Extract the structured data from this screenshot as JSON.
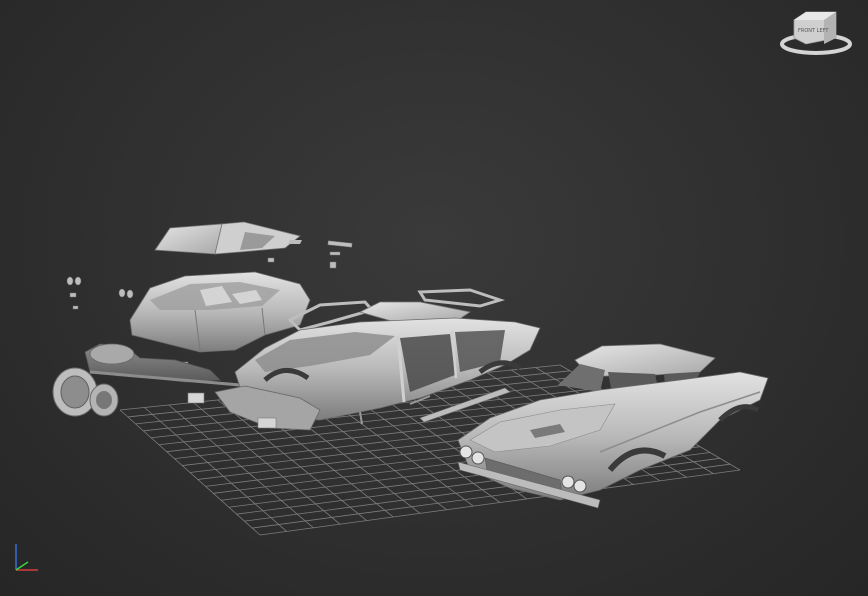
{
  "viewport": {
    "type": "3d-perspective-viewport",
    "background": "#2f2f2f",
    "grid_color": "#8a8a8a",
    "model_color": "#c9c9c9"
  },
  "viewcube": {
    "icon": "viewcube-icon",
    "face_label": "FRONT LEFT"
  },
  "axis_tripod": {
    "icon": "axis-tripod-icon",
    "z_color": "#3a6fd8",
    "x_color": "#d83a3a",
    "y_color": "#3ad83a"
  },
  "scene_objects": [
    "roof-glass-part",
    "windshield-part",
    "door-handle-parts",
    "upper-body-shell",
    "chassis-frame-part",
    "wheel-tire-part",
    "exploded-car-body",
    "assembled-car-body"
  ]
}
